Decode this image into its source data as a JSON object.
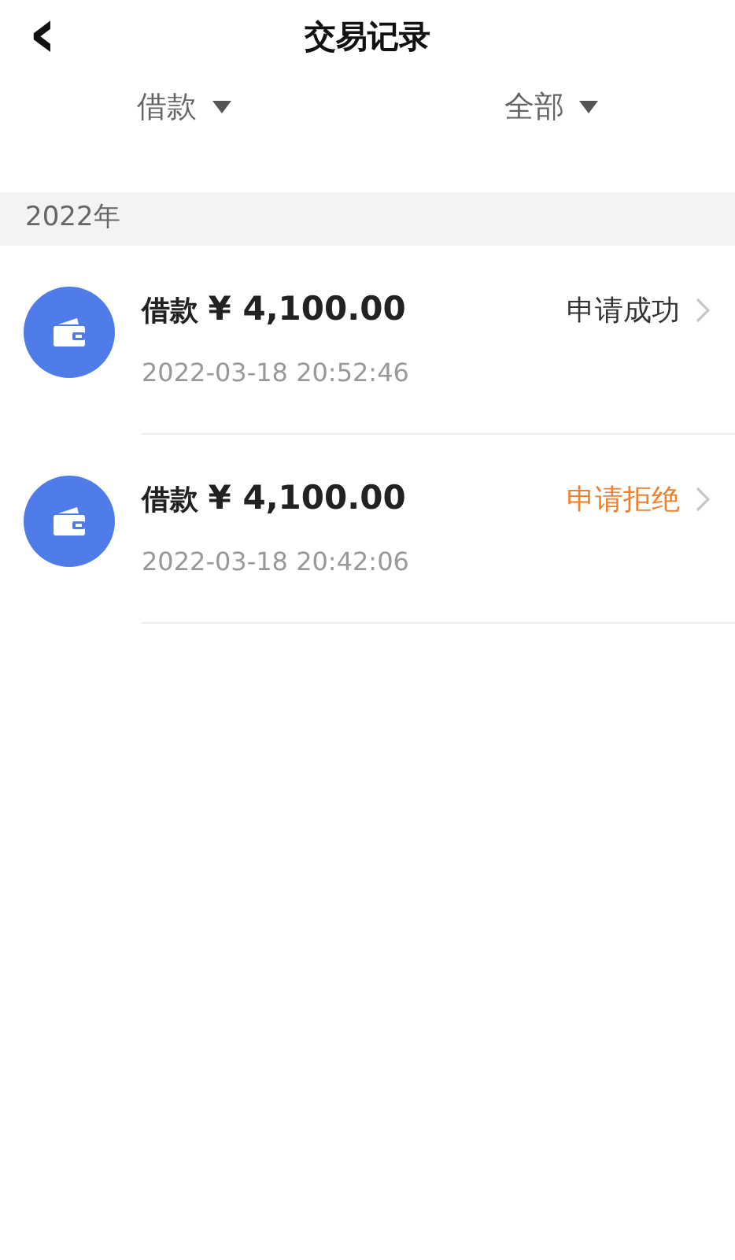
{
  "header": {
    "back": "‹",
    "title": "交易记录"
  },
  "filters": [
    {
      "label": "借款"
    },
    {
      "label": "全部"
    }
  ],
  "sections": [
    {
      "title": "2022年",
      "records": [
        {
          "type_label": "借款",
          "amount": "¥ 4,100.00",
          "status": "申请成功",
          "color": "#333333",
          "time": "2022-03-18 20:52:46"
        },
        {
          "type_label": "借款",
          "amount": "¥ 4,100.00",
          "status": "申请拒绝",
          "color": "#f0802c",
          "time": "2022-03-18 20:42:06"
        }
      ]
    }
  ]
}
